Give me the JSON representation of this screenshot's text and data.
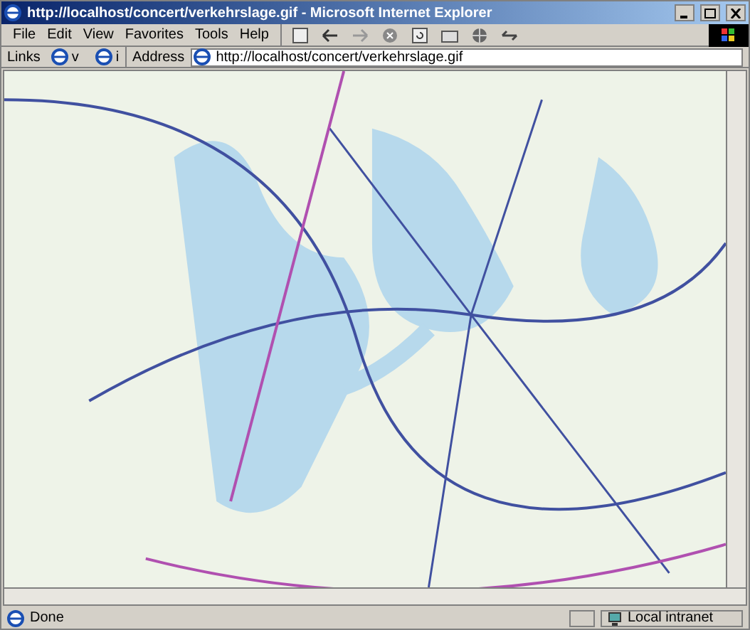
{
  "window": {
    "title": "http://localhost/concert/verkehrslage.gif - Microsoft Internet Explorer"
  },
  "menu": [
    "File",
    "Edit",
    "View",
    "Favorites",
    "Tools",
    "Help"
  ],
  "links": {
    "label": "Links",
    "items": [
      "v",
      "i"
    ]
  },
  "address": {
    "label": "Address",
    "value": "http://localhost/concert/verkehrslage.gif"
  },
  "status_bar": {
    "text": "Done",
    "zone": "Local intranet"
  }
}
